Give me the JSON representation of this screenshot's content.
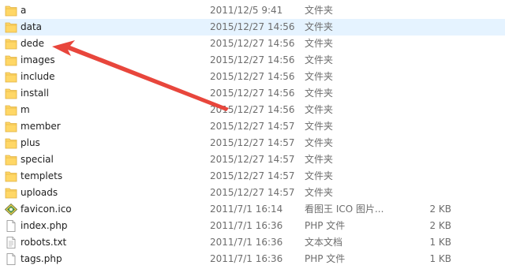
{
  "colors": {
    "folder_fill": "#ffd766",
    "folder_tab": "#e8b94a",
    "hover_bg": "#e5f3ff",
    "annotation_arrow": "#e8463c"
  },
  "files": [
    {
      "name": "a",
      "date": "2011/12/5 9:41",
      "type": "文件夹",
      "size": "",
      "icon": "folder-icon"
    },
    {
      "name": "data",
      "date": "2015/12/27 14:56",
      "type": "文件夹",
      "size": "",
      "icon": "folder-icon"
    },
    {
      "name": "dede",
      "date": "2015/12/27 14:56",
      "type": "文件夹",
      "size": "",
      "icon": "folder-icon"
    },
    {
      "name": "images",
      "date": "2015/12/27 14:56",
      "type": "文件夹",
      "size": "",
      "icon": "folder-icon"
    },
    {
      "name": "include",
      "date": "2015/12/27 14:56",
      "type": "文件夹",
      "size": "",
      "icon": "folder-icon"
    },
    {
      "name": "install",
      "date": "2015/12/27 14:56",
      "type": "文件夹",
      "size": "",
      "icon": "folder-icon"
    },
    {
      "name": "m",
      "date": "2015/12/27 14:56",
      "type": "文件夹",
      "size": "",
      "icon": "folder-icon"
    },
    {
      "name": "member",
      "date": "2015/12/27 14:57",
      "type": "文件夹",
      "size": "",
      "icon": "folder-icon"
    },
    {
      "name": "plus",
      "date": "2015/12/27 14:57",
      "type": "文件夹",
      "size": "",
      "icon": "folder-icon"
    },
    {
      "name": "special",
      "date": "2015/12/27 14:57",
      "type": "文件夹",
      "size": "",
      "icon": "folder-icon"
    },
    {
      "name": "templets",
      "date": "2015/12/27 14:57",
      "type": "文件夹",
      "size": "",
      "icon": "folder-icon"
    },
    {
      "name": "uploads",
      "date": "2015/12/27 14:57",
      "type": "文件夹",
      "size": "",
      "icon": "folder-icon"
    },
    {
      "name": "favicon.ico",
      "date": "2011/7/1 16:14",
      "type": "看图王 ICO 图片...",
      "size": "2 KB",
      "icon": "ico-image-icon"
    },
    {
      "name": "index.php",
      "date": "2011/7/1 16:36",
      "type": "PHP 文件",
      "size": "2 KB",
      "icon": "document-icon"
    },
    {
      "name": "robots.txt",
      "date": "2011/7/1 16:36",
      "type": "文本文档",
      "size": "1 KB",
      "icon": "document-icon"
    },
    {
      "name": "tags.php",
      "date": "2011/7/1 16:36",
      "type": "PHP 文件",
      "size": "1 KB",
      "icon": "document-icon"
    }
  ]
}
